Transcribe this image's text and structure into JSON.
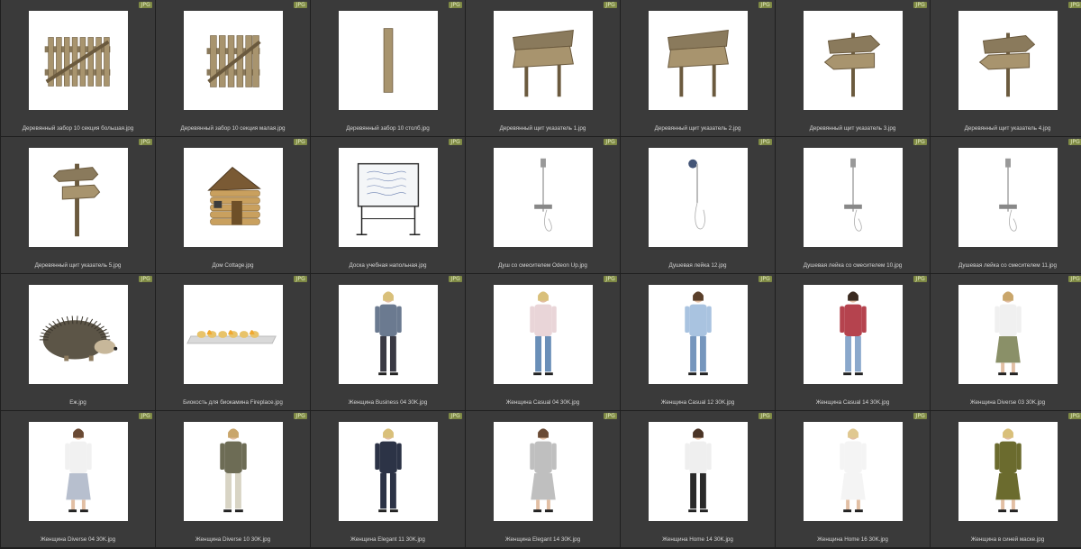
{
  "badge_label": "JPG",
  "colors": {
    "background": "#2b2b2b",
    "cell": "#3a3a3a",
    "badge": "#7f8a45",
    "caption": "#d4d4d4"
  },
  "files": [
    {
      "name": "Деревянный забор 10 секция большая.jpg",
      "icon": "wooden-fence-icon"
    },
    {
      "name": "Деревянный забор 10 секция малая.jpg",
      "icon": "wooden-gate-icon"
    },
    {
      "name": "Деревянный забор 10 столб.jpg",
      "icon": "wooden-post-icon"
    },
    {
      "name": "Деревянный щит указатель 1.jpg",
      "icon": "wooden-signboard-icon"
    },
    {
      "name": "Деревянный щит указатель 2.jpg",
      "icon": "wooden-signboard-icon"
    },
    {
      "name": "Деревянный щит указатель 3.jpg",
      "icon": "wooden-arrow-sign-icon"
    },
    {
      "name": "Деревянный щит указатель 4.jpg",
      "icon": "wooden-arrow-sign-icon"
    },
    {
      "name": "Деревянный щит указатель 5.jpg",
      "icon": "wooden-direction-sign-icon"
    },
    {
      "name": "Дом Cottage.jpg",
      "icon": "log-cabin-icon"
    },
    {
      "name": "Доска учебная напольная.jpg",
      "icon": "whiteboard-icon"
    },
    {
      "name": "Душ со смесителем Odeon Up.jpg",
      "icon": "shower-icon"
    },
    {
      "name": "Душевая лейка 12.jpg",
      "icon": "shower-head-icon"
    },
    {
      "name": "Душевая лейка со смесителем 10.jpg",
      "icon": "shower-icon"
    },
    {
      "name": "Душевая лейка со смесителем 11.jpg",
      "icon": "shower-icon"
    },
    {
      "name": "Еж.jpg",
      "icon": "hedgehog-icon"
    },
    {
      "name": "Биокость для биокамина Fireplace.jpg",
      "icon": "fireplace-logs-icon"
    },
    {
      "name": "Женщина Business 04 30K.jpg",
      "icon": "woman-figure-icon"
    },
    {
      "name": "Женщина Casual 04 30K.jpg",
      "icon": "woman-figure-icon"
    },
    {
      "name": "Женщина Casual 12 30K.jpg",
      "icon": "woman-figure-icon"
    },
    {
      "name": "Женщина Casual 14 30K.jpg",
      "icon": "woman-figure-icon"
    },
    {
      "name": "Женщина Diverse 03 30K.jpg",
      "icon": "woman-figure-icon"
    },
    {
      "name": "Женщина Diverse 04 30K.jpg",
      "icon": "woman-figure-icon"
    },
    {
      "name": "Женщина Diverse 10 30K.jpg",
      "icon": "woman-figure-icon"
    },
    {
      "name": "Женщина Elegant 11 30K.jpg",
      "icon": "woman-figure-icon"
    },
    {
      "name": "Женщина Elegant 14 30K.jpg",
      "icon": "woman-figure-icon"
    },
    {
      "name": "Женщина Home 14 30K.jpg",
      "icon": "woman-figure-icon"
    },
    {
      "name": "Женщина Home 16 30K.jpg",
      "icon": "woman-figure-icon"
    },
    {
      "name": "Женщина в синей маске.jpg",
      "icon": "woman-figure-icon"
    }
  ]
}
